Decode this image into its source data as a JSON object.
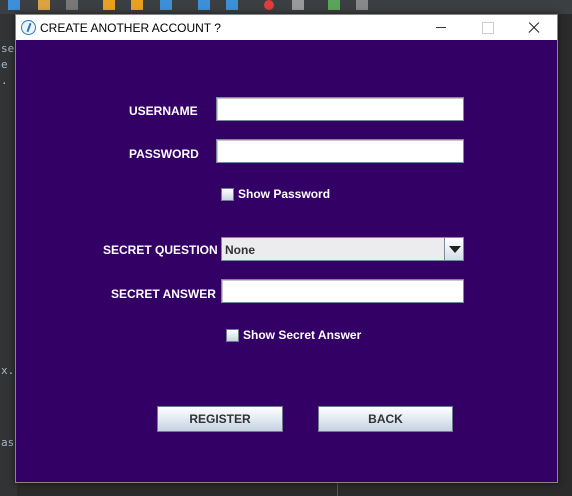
{
  "window": {
    "title": "CREATE ANOTHER ACCOUNT ?"
  },
  "form": {
    "username_label": "USERNAME",
    "username_value": "",
    "password_label": "PASSWORD",
    "password_value": "",
    "show_password_label": "Show Password",
    "show_password_checked": false,
    "secret_question_label": "SECRET QUESTION",
    "secret_question_selected": "None",
    "secret_answer_label": "SECRET ANSWER",
    "secret_answer_value": "",
    "show_secret_answer_label": "Show Secret Answer",
    "show_secret_answer_checked": false
  },
  "buttons": {
    "register": "REGISTER",
    "back": "BACK"
  },
  "background_ide": {
    "gutter_fragments": [
      "se",
      "e",
      ".",
      "x.",
      "as"
    ]
  },
  "colors": {
    "panel_background": "#330066",
    "label_text": "#ffffff",
    "ide_background": "#2b2b2b"
  }
}
